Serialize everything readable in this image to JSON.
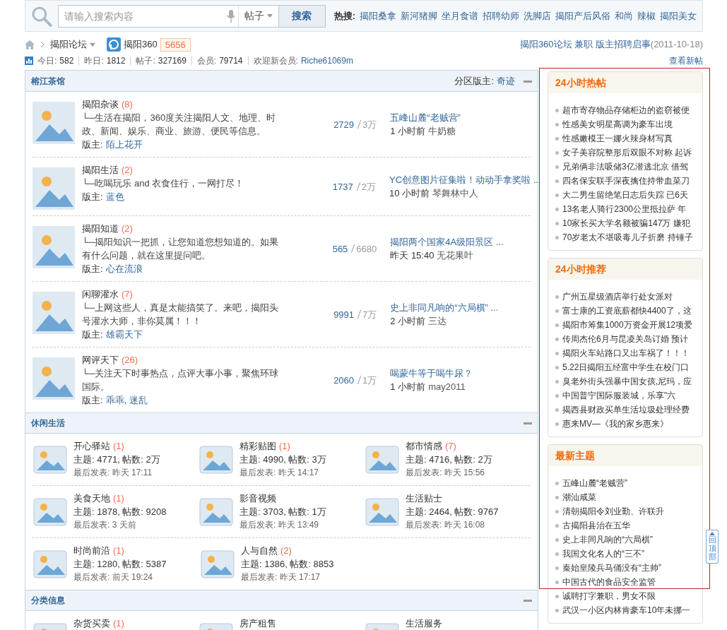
{
  "search": {
    "placeholder": "请输入搜索内容",
    "scope": "帖子",
    "button": "搜索",
    "hot_label": "热搜:",
    "hot_terms": [
      "揭阳桑拿",
      "新河猪脚",
      "坐月食谱",
      "招聘幼师",
      "洗脚店",
      "揭阳产后风俗",
      "和尚",
      "辣椒",
      "揭阳美女"
    ]
  },
  "breadcrumb": {
    "forum": "揭阳论坛",
    "site": "揭阳360",
    "site_count": "5656",
    "notice": "揭阳360论坛 兼职 版主招聘启事",
    "notice_date": "(2011-10-18)"
  },
  "stats": {
    "items": [
      {
        "label": "今日:",
        "value": "582"
      },
      {
        "label": "昨日:",
        "value": "1812"
      },
      {
        "label": "帖子:",
        "value": "327169"
      },
      {
        "label": "会员:",
        "value": "79714"
      }
    ],
    "welcome_label": "欢迎新会员:",
    "new_member": "Riche61069m",
    "new_posts_link": "查看新帖"
  },
  "sections": [
    {
      "title": "榕江茶馆",
      "kind": "list",
      "moderator_label": "分区版主:",
      "moderator": "奇迹",
      "forums": [
        {
          "name": "揭阳杂谈",
          "count": "(8)",
          "desc": "└─生活在揭阳，360度关注揭阳人文、地理、时政、新闻、娱乐、商业、旅游、便民等信息。",
          "moderator_label": "版主:",
          "moderators": "陌上花开",
          "threads": "2729",
          "posts": "3万",
          "last_title": "五峰山麓“老贼营”",
          "last_time": "1 小时前",
          "last_user": "牛奶糖"
        },
        {
          "name": "揭阳生活",
          "count": "(2)",
          "desc": "└─吃喝玩乐 and 衣食住行，一网打尽！",
          "moderator_label": "版主:",
          "moderators": "蓝色",
          "threads": "1737",
          "posts": "2万",
          "last_title": "YC创意图片征集啦！动动手拿奖啦 ...",
          "last_time": "10 小时前",
          "last_user": "琴舞林中人"
        },
        {
          "name": "揭阳知道",
          "count": "(2)",
          "desc": "└─揭阳知识一把抓，让您知道您想知道的。如果有什么问题，就在这里提问吧。",
          "moderator_label": "版主:",
          "moderators": "心在流浪",
          "threads": "565",
          "posts": "6680",
          "last_title": "揭阳两个国家4A级阳景区 ...",
          "last_time": "昨天 15:40",
          "last_user": "无花果叶"
        },
        {
          "name": "闲聊灌水",
          "count": "(7)",
          "desc": "└─上网这些人，真是太能搞笑了。来吧，揭阳头号灌水大师，非你莫属！！！",
          "moderator_label": "版主:",
          "moderators": "雄霸天下",
          "threads": "9991",
          "posts": "7万",
          "last_title": "史上非同凡响的“六局棋” ...",
          "last_time": "2 小时前",
          "last_user": "三达"
        },
        {
          "name": "网评天下",
          "count": "(26)",
          "desc": "└─关注天下时事热点，点评大事小事，聚焦环球国际。",
          "moderator_label": "版主:",
          "moderators": "乖乖, 迷乱",
          "threads": "2060",
          "posts": "1万",
          "last_title": "喝蒙牛等于喝牛尿？",
          "last_time": "1 小时前",
          "last_user": "may2011"
        }
      ]
    },
    {
      "title": "休闲生活",
      "kind": "grid",
      "forums": [
        {
          "name": "开心驿站",
          "count": "(1)",
          "stats": "主题: 4771, 帖数: 2万",
          "last": "最后发表: 昨天 17:11"
        },
        {
          "name": "精彩贴图",
          "count": "(1)",
          "stats": "主题: 4990, 帖数: 3万",
          "last": "最后发表: 昨天 14:17"
        },
        {
          "name": "都市情感",
          "count": "(7)",
          "stats": "主题: 4716, 帖数: 2万",
          "last": "最后发表: 昨天 15:56"
        },
        {
          "name": "美食天地",
          "count": "(1)",
          "stats": "主题: 1878, 帖数: 9208",
          "last": "最后发表: 3 天前"
        },
        {
          "name": "影音视频",
          "stats": "主题: 3703, 帖数: 1万",
          "last": "最后发表: 昨天 13:49"
        },
        {
          "name": "生活贴士",
          "stats": "主题: 2464, 帖数: 9767",
          "last": "最后发表: 昨天 16:08"
        },
        {
          "name": "时尚前沿",
          "count": "(1)",
          "stats": "主题: 1280, 帖数: 5387",
          "last": "最后发表: 前天 19:24"
        },
        {
          "name": "人与自然",
          "count": "(2)",
          "stats": "主题: 1386, 帖数: 8853",
          "last": "最后发表: 昨天 17:17"
        }
      ]
    },
    {
      "title": "分类信息",
      "kind": "grid",
      "forums": [
        {
          "name": "杂货买卖",
          "count": "(1)"
        },
        {
          "name": "房产租售"
        },
        {
          "name": "生活服务"
        }
      ]
    }
  ],
  "sidebar": [
    {
      "title": "24小时热帖",
      "items": [
        "超市寄存物品存储柜边的盗窃被便",
        "性感美女明星高调为豪车出境",
        "性感嫩模王一娜火辣身材写真",
        "女子美容院整形后双眼不对称 起诉",
        "兄弟俩非法吸储3亿潜逃北京 借驾",
        "四名保安联手深夜擒住持带血菜刀",
        "大二男生留绝笔日志后失踪 已6天",
        "13名老人骑行2300公里抵拉萨 年",
        "10家长买大学名额被骗147万 嫌犯",
        "70岁老太不堪吸毒儿子折磨 持锤子"
      ]
    },
    {
      "title": "24小时推荐",
      "items": [
        "广州五星级酒店举行处女派对",
        "富士康的工资底薪都快4400了，这",
        "揭阳市筹集1000万资金开展12项爱",
        "传周杰伦6月与昆凌关岛订婚 预计",
        "揭阳火车站路口又出车祸了！！！",
        "5.22日揭阳五经富中学生在校门口",
        "臭老外街头强暴中国女孩,尼玛，应",
        "中国普宁国际服装城，乐享\"六",
        "揭西县财政买单生活垃圾处理经费",
        "惠来MV—《我的家乡惠来》"
      ]
    },
    {
      "title": "最新主题",
      "items": [
        "五峰山麓“老贼营”",
        "潮汕咸菜",
        "清朝揭阳令刘业勤、许联升",
        "古揭阳县治在五华",
        "史上非同凡响的“六局棋”",
        "我国文化名人的“三不”",
        "秦始皇陵兵马俑没有“主帅”",
        "中国古代的食品安全监管",
        "诚聘打字兼职，男女不限",
        "武汉一小区内林肯豪车10年未挪一"
      ]
    }
  ],
  "back_to_top": "回顶部"
}
